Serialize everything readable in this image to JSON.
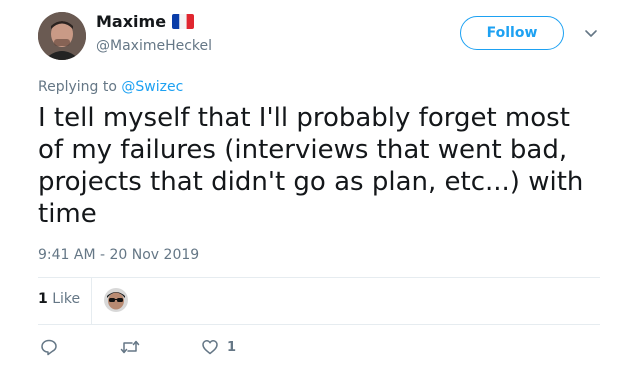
{
  "author": {
    "name": "Maxime",
    "handle": "@MaximeHeckel",
    "flag_icon": "france-flag-icon"
  },
  "follow_label": "Follow",
  "more_icon": "chevron-down-icon",
  "reply_context": {
    "prefix": "Replying to ",
    "mention": "@Swizec"
  },
  "tweet_text": "I tell myself that I'll probably forget most of my failures (interviews that went bad, projects that didn't go as plan, etc...) with time",
  "timestamp": "9:41 AM - 20 Nov 2019",
  "stats": {
    "like_count": "1",
    "like_label": " Like"
  },
  "actions": {
    "reply_icon": "reply-icon",
    "retweet_icon": "retweet-icon",
    "like_icon": "heart-icon",
    "like_count": "1"
  },
  "colors": {
    "accent": "#1da1f2",
    "text": "#14171a",
    "muted": "#657786",
    "divider": "#e6ecf0"
  }
}
